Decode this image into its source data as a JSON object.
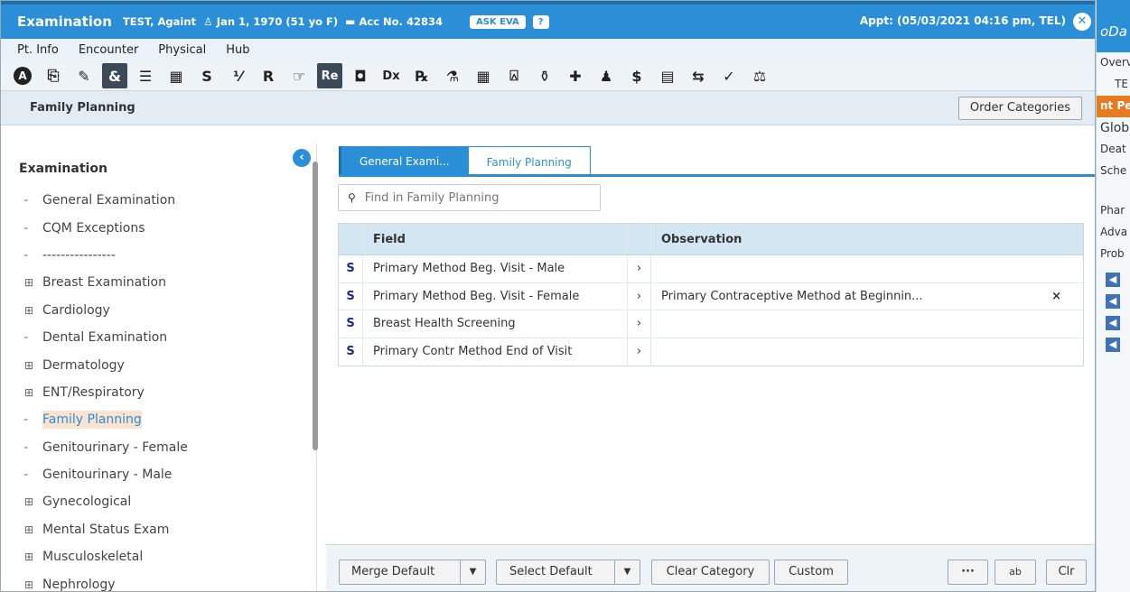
{
  "window": {
    "title": "Examination",
    "patient": "TEST, Againt",
    "dob": "Jan 1, 1970 (51 yo F)",
    "acc": "Acc No. 42834",
    "ask_eva": "ASK EVA",
    "help": "?",
    "appt": "Appt: (05/03/2021 04:16 pm, TEL)"
  },
  "menu": [
    "Pt. Info",
    "Encounter",
    "Physical",
    "Hub"
  ],
  "toolbar": {
    "icons": [
      "A",
      "⎘",
      "✎",
      "&",
      "☰",
      "▦",
      "S",
      "⅟",
      "R",
      "☞",
      "Re",
      "◘",
      "Dx",
      "℞",
      "⚗",
      "▦",
      "⍓",
      "⚱",
      "✚",
      "♟",
      "$",
      "▤",
      "⇆",
      "✓",
      "⚖"
    ]
  },
  "section": {
    "title": "Family Planning",
    "order_button": "Order Categories"
  },
  "left": {
    "title": "Examination",
    "items": [
      {
        "label": "General Examination",
        "expand": false
      },
      {
        "label": "CQM Exceptions",
        "expand": false
      },
      {
        "label": "----------------",
        "expand": false
      },
      {
        "label": "Breast Examination",
        "expand": true
      },
      {
        "label": "Cardiology",
        "expand": true
      },
      {
        "label": "Dental Examination",
        "expand": false
      },
      {
        "label": "Dermatology",
        "expand": true
      },
      {
        "label": "ENT/Respiratory",
        "expand": true
      },
      {
        "label": "Family Planning",
        "expand": false,
        "selected": true
      },
      {
        "label": "Genitourinary - Female",
        "expand": false
      },
      {
        "label": "Genitourinary - Male",
        "expand": false
      },
      {
        "label": "Gynecological",
        "expand": true
      },
      {
        "label": "Mental Status Exam",
        "expand": true
      },
      {
        "label": "Musculoskeletal",
        "expand": true
      },
      {
        "label": "Nephrology",
        "expand": true
      }
    ]
  },
  "tabs": [
    "General Exami...",
    "Family Planning"
  ],
  "search": {
    "placeholder": "Find in Family Planning"
  },
  "grid": {
    "columns": [
      "Field",
      "Observation"
    ],
    "rows": [
      {
        "s": "S",
        "field": "Primary Method Beg. Visit - Male",
        "observation": ""
      },
      {
        "s": "S",
        "field": "Primary Method Beg. Visit - Female",
        "observation": "Primary Contraceptive Method at Beginnin..."
      },
      {
        "s": "S",
        "field": "Breast Health Screening",
        "observation": ""
      },
      {
        "s": "S",
        "field": "Primary Contr Method End of Visit",
        "observation": ""
      }
    ]
  },
  "footer": {
    "merge_default": "Merge Default",
    "select_default": "Select Default",
    "clear_category": "Clear Category",
    "custom": "Custom",
    "more": "···",
    "spell": "ab",
    "clr": "Clr"
  },
  "background_app": {
    "rows": [
      "Overvie",
      "TE",
      "nt Pe",
      "Glob",
      "Deat",
      "Sche",
      "Phar",
      "Adva",
      "Prob"
    ]
  }
}
